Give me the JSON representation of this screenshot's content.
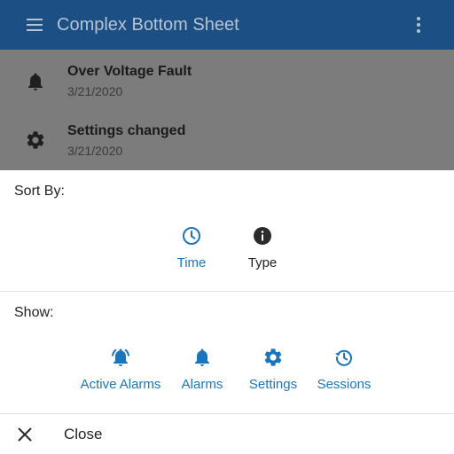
{
  "colors": {
    "appbar_bg": "#1c4f84",
    "appbar_text": "#b7c3d1",
    "scrim_bg": "#7c7c7c",
    "list_title": "#1a1a1a",
    "list_date": "#3a3a3a",
    "list_icon": "#1f1f1f",
    "accent": "#1b75bc",
    "icon_dark": "#2b2b2b",
    "text_dark": "#222222"
  },
  "appbar": {
    "title": "Complex Bottom Sheet",
    "menu_icon": "menu-icon",
    "more_icon": "more-vert-icon"
  },
  "list": {
    "items": [
      {
        "icon": "bell-icon",
        "title": "Over Voltage Fault",
        "date": "3/21/2020"
      },
      {
        "icon": "gear-icon",
        "title": "Settings changed",
        "date": "3/21/2020"
      }
    ]
  },
  "sheet": {
    "sort": {
      "title": "Sort By:",
      "options": [
        {
          "icon": "clock-icon",
          "label": "Time",
          "selected": true
        },
        {
          "icon": "info-icon",
          "label": "Type",
          "selected": false
        }
      ]
    },
    "show": {
      "title": "Show:",
      "options": [
        {
          "icon": "active-alarm-icon",
          "label": "Active Alarms"
        },
        {
          "icon": "bell-icon",
          "label": "Alarms"
        },
        {
          "icon": "gear-icon",
          "label": "Settings"
        },
        {
          "icon": "history-icon",
          "label": "Sessions"
        }
      ]
    },
    "close": {
      "icon": "close-icon",
      "label": "Close"
    }
  }
}
